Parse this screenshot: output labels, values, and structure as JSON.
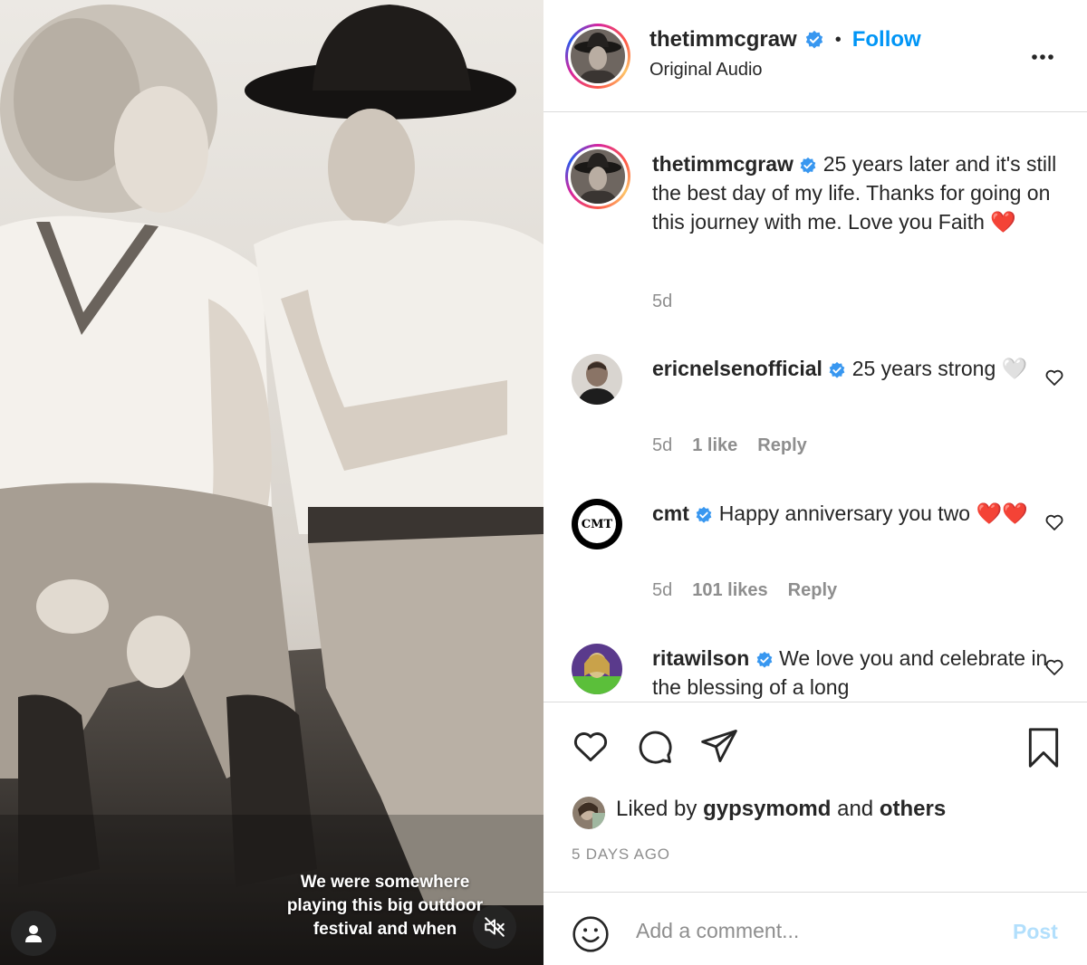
{
  "media": {
    "caption_overlay": [
      "We were somewhere",
      "playing this big outdoor",
      "festival and when"
    ],
    "user_tag_icon": "user-icon",
    "mute_icon": "speaker-muted-icon"
  },
  "header": {
    "username": "thetimmcgraw",
    "verified_icon": "verified-badge-icon",
    "separator": "•",
    "follow_label": "Follow",
    "audio_label": "Original Audio",
    "more_icon": "more-options-icon"
  },
  "caption": {
    "username": "thetimmcgraw",
    "text": "25 years later and it's still the best day of my life. Thanks for going on this journey with me. Love you Faith",
    "emoji": "❤️",
    "time": "5d"
  },
  "comments": [
    {
      "username": "ericnelsenofficial",
      "text": "25 years strong",
      "emoji": "🤍",
      "time": "5d",
      "likes": "1 like",
      "reply": "Reply"
    },
    {
      "username": "cmt",
      "text": "Happy anniversary you two",
      "emoji": "❤️❤️",
      "time": "5d",
      "likes": "101 likes",
      "reply": "Reply",
      "avatar_text": "CMT"
    },
    {
      "username": "ritawilson",
      "text": "We love you and celebrate in the blessing of a long"
    }
  ],
  "actions": {
    "like_icon": "heart-icon",
    "comment_icon": "comment-icon",
    "share_icon": "send-icon",
    "save_icon": "bookmark-icon",
    "liked_prefix": "Liked by",
    "liked_user": "gypsymomd",
    "liked_and": "and",
    "liked_others": "others",
    "date": "5 DAYS AGO"
  },
  "add_comment": {
    "emoji_icon": "smiley-icon",
    "placeholder": "Add a comment...",
    "post_label": "Post"
  },
  "colors": {
    "link_blue": "#0095f6",
    "muted_gray": "#8e8e8e",
    "border": "#dbdbdb",
    "post_disabled": "#b2dffc"
  }
}
